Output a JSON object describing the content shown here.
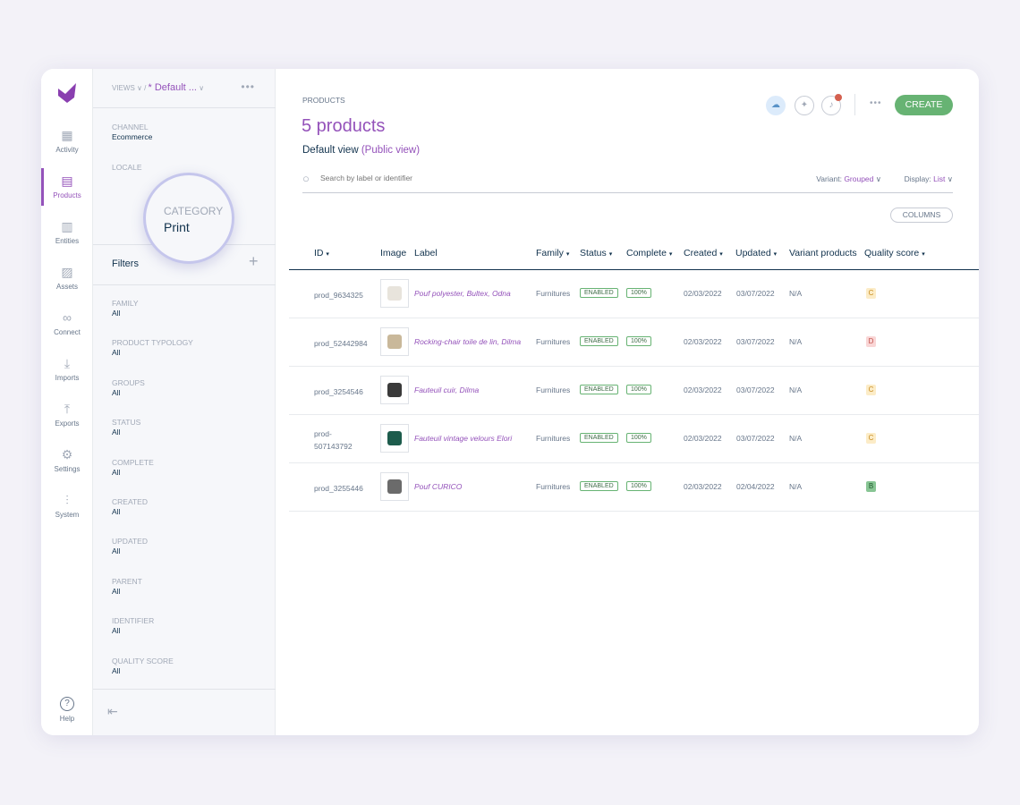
{
  "colors": {
    "accent": "#9452ba",
    "create": "#67b373",
    "qs_c": "#fcecc7",
    "qs_d": "#f9d6d6",
    "qs_b": "#88c594"
  },
  "nav": {
    "items": [
      {
        "label": "Activity",
        "icon": "grid-icon"
      },
      {
        "label": "Products",
        "icon": "clipboard-icon",
        "active": true
      },
      {
        "label": "Entities",
        "icon": "entities-icon"
      },
      {
        "label": "Assets",
        "icon": "image-icon"
      },
      {
        "label": "Connect",
        "icon": "link-icon"
      },
      {
        "label": "Imports",
        "icon": "import-icon"
      },
      {
        "label": "Exports",
        "icon": "export-icon"
      },
      {
        "label": "Settings",
        "icon": "gear-icon"
      },
      {
        "label": "System",
        "icon": "sliders-icon"
      }
    ],
    "help": "Help"
  },
  "panel": {
    "views_label": "VIEWS",
    "view_name": "* Default ...",
    "channel": {
      "label": "CHANNEL",
      "value": "Ecommerce"
    },
    "locale": {
      "label": "LOCALE"
    },
    "category": {
      "label": "CATEGORY",
      "value": "Print"
    },
    "filters_title": "Filters",
    "filters": [
      {
        "label": "FAMILY",
        "value": "All"
      },
      {
        "label": "PRODUCT TYPOLOGY",
        "value": "All"
      },
      {
        "label": "GROUPS",
        "value": "All"
      },
      {
        "label": "STATUS",
        "value": "All"
      },
      {
        "label": "COMPLETE",
        "value": "All"
      },
      {
        "label": "CREATED",
        "value": "All"
      },
      {
        "label": "UPDATED",
        "value": "All"
      },
      {
        "label": "PARENT",
        "value": "All"
      },
      {
        "label": "IDENTIFIER",
        "value": "All"
      },
      {
        "label": "QUALITY SCORE",
        "value": "All"
      }
    ]
  },
  "header": {
    "breadcrumb": "PRODUCTS",
    "title": "5 products",
    "view": "Default view",
    "view_sub": "(Public view)",
    "create": "CREATE",
    "search_placeholder": "Search by label or identifier",
    "variant_label": "Variant:",
    "variant_value": "Grouped",
    "display_label": "Display:",
    "display_value": "List",
    "columns_button": "COLUMNS"
  },
  "table": {
    "columns": [
      "ID",
      "Image",
      "Label",
      "Family",
      "Status",
      "Complete",
      "Created",
      "Updated",
      "Variant products",
      "Quality score"
    ],
    "rows": [
      {
        "id": "prod_9634325",
        "label": "Pouf polyester, Bultex, Odna",
        "family": "Furnitures",
        "status": "ENABLED",
        "complete": "100%",
        "created": "02/03/2022",
        "updated": "03/07/2022",
        "variants": "N/A",
        "quality": "C"
      },
      {
        "id": "prod_52442984",
        "label": "Rocking-chair toile de lin, Dilma",
        "family": "Furnitures",
        "status": "ENABLED",
        "complete": "100%",
        "created": "02/03/2022",
        "updated": "03/07/2022",
        "variants": "N/A",
        "quality": "D"
      },
      {
        "id": "prod_3254546",
        "label": "Fauteuil cuir, Dilma",
        "family": "Furnitures",
        "status": "ENABLED",
        "complete": "100%",
        "created": "02/03/2022",
        "updated": "03/07/2022",
        "variants": "N/A",
        "quality": "C"
      },
      {
        "id": "prod-\n507143792",
        "label": "Fauteuil vintage velours Elori",
        "family": "Furnitures",
        "status": "ENABLED",
        "complete": "100%",
        "created": "02/03/2022",
        "updated": "03/07/2022",
        "variants": "N/A",
        "quality": "C"
      },
      {
        "id": "prod_3255446",
        "label": "Pouf CURICO",
        "family": "Furnitures",
        "status": "ENABLED",
        "complete": "100%",
        "created": "02/03/2022",
        "updated": "02/04/2022",
        "variants": "N/A",
        "quality": "B"
      }
    ]
  }
}
